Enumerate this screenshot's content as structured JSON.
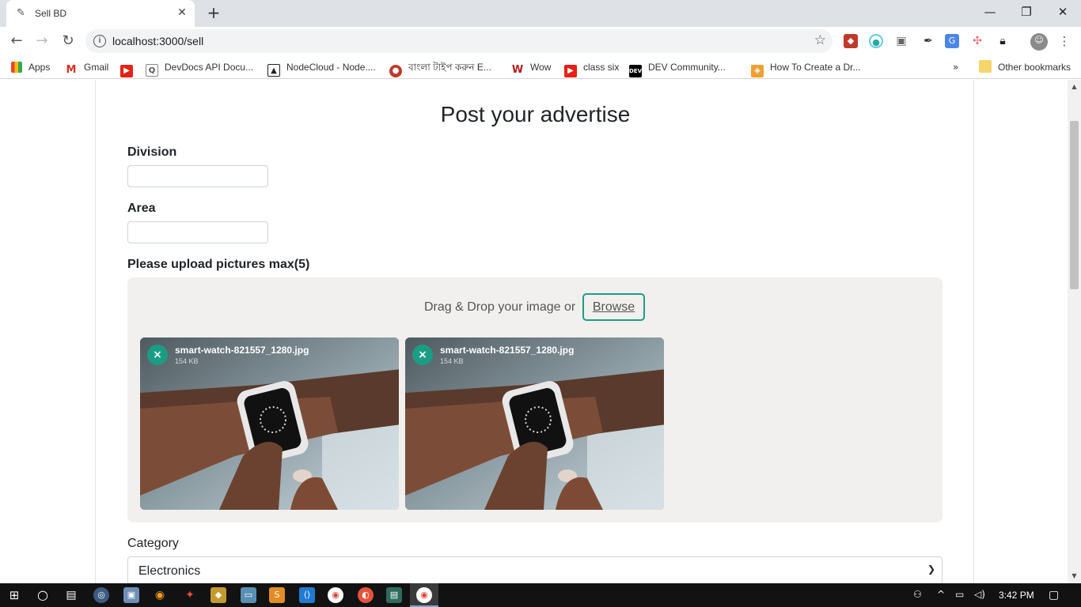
{
  "browser": {
    "tab_title": "Sell BD",
    "url": "localhost:3000/sell",
    "bookmarks": [
      {
        "label": "Apps",
        "icon": "apps-grid-icon"
      },
      {
        "label": "Gmail",
        "icon": "gmail-icon"
      },
      {
        "label": "",
        "icon": "youtube-icon"
      },
      {
        "label": "DevDocs API Docu...",
        "icon": "devdocs-icon"
      },
      {
        "label": "NodeCloud - Node....",
        "icon": "nodecloud-icon"
      },
      {
        "label": "বাংলা টাইপ করুন E...",
        "icon": "bangla-type-icon"
      },
      {
        "label": "Wow",
        "icon": "wow-icon"
      },
      {
        "label": "class six",
        "icon": "youtube-icon"
      },
      {
        "label": "DEV Community...",
        "icon": "dev-icon"
      },
      {
        "label": "How To Create a Dr...",
        "icon": "codepen-icon"
      }
    ],
    "overflow": "»",
    "other_bookmarks": "Other bookmarks"
  },
  "page": {
    "title": "Post your advertise",
    "division_label": "Division",
    "area_label": "Area",
    "upload_label": "Please upload pictures max(5)",
    "dropzone_text": "Drag & Drop your image or",
    "browse_label": "Browse",
    "files": [
      {
        "name": "smart-watch-821557_1280.jpg",
        "size": "154 KB",
        "remove": "×"
      },
      {
        "name": "smart-watch-821557_1280.jpg",
        "size": "154 KB",
        "remove": "×"
      }
    ],
    "category_label": "Category",
    "category_value": "Electronics"
  },
  "taskbar": {
    "time": "3:42 PM"
  },
  "colors": {
    "accent": "#1f9c88",
    "dropzone_bg": "#f1f0ef",
    "taskbar_bg": "#121212"
  }
}
